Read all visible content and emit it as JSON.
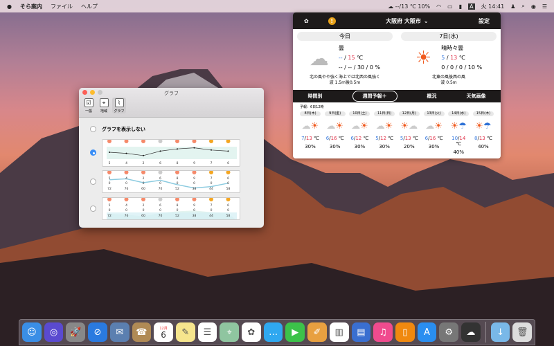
{
  "menubar": {
    "apple": "",
    "app": "そら案内",
    "menus": [
      "ファイル",
      "ヘルプ"
    ],
    "weather": "--/13 ℃ 10%",
    "ime": "A",
    "clock": "火 14:41"
  },
  "popover": {
    "location": "大阪府 大阪市",
    "settings": "設定",
    "today": {
      "label": "今日",
      "weather": "曇",
      "temp_low": "--",
      "temp_high": "15",
      "temp_unit": "℃",
      "rain": "-- / -- / 30 / 0 %",
      "wind": "北の風やや強く海上では北西の風強く",
      "wave": "波 1.5m後0.5m"
    },
    "tomorrow": {
      "label": "7日(水)",
      "weather": "晴時々曇",
      "temp_low": "5",
      "temp_high": "13",
      "temp_unit": "℃",
      "rain": "0 / 0 / 0 / 10 %",
      "wind": "北東の風後西の風",
      "wave": "波 0.5m"
    },
    "tabs": [
      "時間別",
      "週間予報＋",
      "概況",
      "天気画像"
    ],
    "note": "予報：6日12時",
    "days": [
      {
        "date": "8日(木)",
        "icon": "cloud-sun",
        "low": "7",
        "high": "13",
        "pop": "30%"
      },
      {
        "date": "9日(金)",
        "icon": "cloud-sun",
        "low": "6",
        "high": "16",
        "pop": "30%"
      },
      {
        "date": "10日(土)",
        "icon": "cloud-sun",
        "low": "6",
        "high": "12",
        "pop": "30%"
      },
      {
        "date": "11日(日)",
        "icon": "cloud-sun",
        "low": "5",
        "high": "12",
        "pop": "30%"
      },
      {
        "date": "12日(月)",
        "icon": "sun-cloud",
        "low": "5",
        "high": "13",
        "pop": "20%"
      },
      {
        "date": "13日(火)",
        "icon": "cloud-sun",
        "low": "6",
        "high": "16",
        "pop": "30%"
      },
      {
        "date": "14日(水)",
        "icon": "sun-umbrella",
        "low": "10",
        "high": "14",
        "pop": "40%"
      },
      {
        "date": "15日(木)",
        "icon": "sun-umbrella",
        "low": "8",
        "high": "13",
        "pop": "40%"
      }
    ]
  },
  "prefs": {
    "title": "グラフ",
    "tools": [
      "一般",
      "地域",
      "グラフ"
    ],
    "no_graph": "グラフを表示しない",
    "graph": {
      "temps": [
        5,
        4,
        2,
        6,
        8,
        9,
        7,
        6
      ],
      "rain": [
        0,
        0,
        0,
        0,
        0,
        0,
        0,
        0
      ],
      "humidity": [
        72,
        76,
        60,
        70,
        52,
        38,
        44,
        58
      ]
    },
    "selected": 1
  },
  "dock": [
    "Finder",
    "Siri",
    "Launchpad",
    "Safari",
    "Mail",
    "Contacts",
    "Calendar",
    "Notes",
    "Reminders",
    "Maps",
    "Photos",
    "Messages",
    "FaceTime",
    "Pages",
    "Numbers",
    "Keynote",
    "iTunes",
    "iBooks",
    "App Store",
    "System Preferences",
    "そら案内",
    "Downloads",
    "Trash"
  ],
  "dock_calendar": {
    "month": "12月",
    "day": "6"
  },
  "colors": {
    "accent": "#3a8ef6",
    "low": "#3b7de0",
    "high": "#e0334a"
  }
}
